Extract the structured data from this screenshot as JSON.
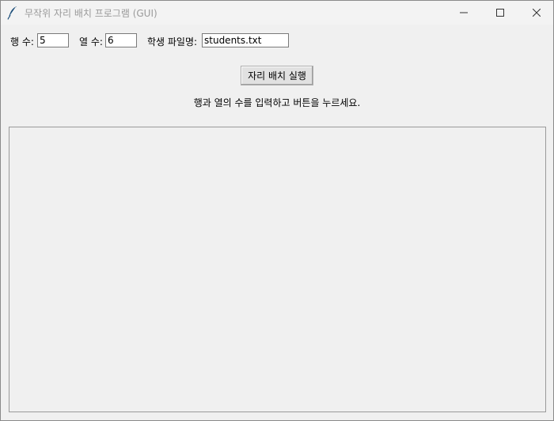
{
  "window": {
    "title": "무작위 자리 배치 프로그램 (GUI)",
    "controls": {
      "minimize": "minimize-icon",
      "maximize": "maximize-icon",
      "close": "close-icon"
    }
  },
  "form": {
    "rows": {
      "label": "행 수:",
      "value": "5"
    },
    "cols": {
      "label": "열 수:",
      "value": "6"
    },
    "file": {
      "label": "학생 파일명:",
      "value": "students.txt"
    }
  },
  "actions": {
    "run_label": "자리 배치 실행"
  },
  "status": {
    "message": "행과 열의 수를 입력하고 버튼을 누르세요."
  },
  "colors": {
    "background": "#f0f0f0",
    "title_text": "#9a9a9a",
    "icon_blue": "#1e4f7a"
  }
}
